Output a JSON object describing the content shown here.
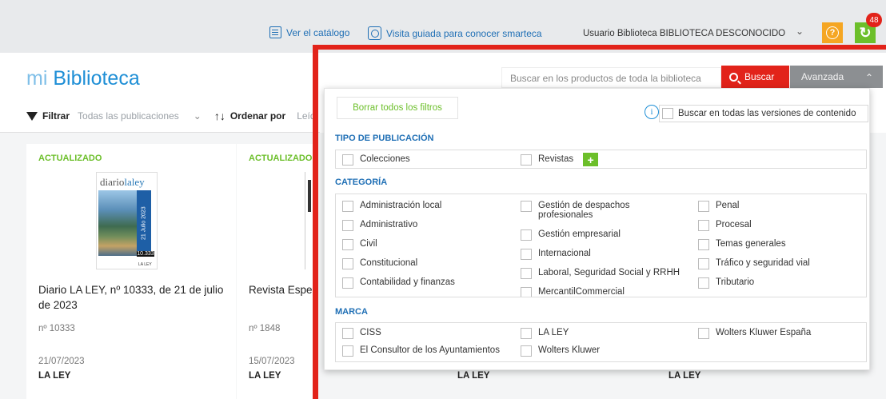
{
  "topbar": {
    "catalog_label": "Ver el catálogo",
    "tour_label": "Visita guiada para conocer smarteca",
    "user_label": "Usuario Biblioteca BIBLIOTECA DESCONOCIDO",
    "notification_count": "48"
  },
  "library": {
    "title_prefix": "mi",
    "title_main": "Biblioteca",
    "filter_label": "Filtrar",
    "filter_value": "Todas las publicaciones",
    "order_label": "Ordenar por",
    "order_value": "Leíd"
  },
  "cards": [
    {
      "status": "ACTUALIZADO",
      "title": "Diario LA LEY, nº 10333, de 21 de julio de 2023",
      "number": "nº 10333",
      "date": "21/07/2023",
      "brand": "LA LEY",
      "cover_logo_a": "diario",
      "cover_logo_b": "laley",
      "cover_date": "21 Julio 2023",
      "cover_num": "10.333",
      "cover_wk": "LA LEY"
    },
    {
      "status": "ACTUALIZADO",
      "title": "Revista Espec",
      "number": "nº 1848",
      "date": "15/07/2023",
      "brand": "LA LEY"
    }
  ],
  "background_brands": [
    "LA LEY",
    "LA LEY"
  ],
  "search": {
    "placeholder": "Buscar en los productos de toda la biblioteca",
    "button_label": "Buscar",
    "advanced_label": "Avanzada"
  },
  "panel": {
    "clear_label": "Borrar todos los filtros",
    "all_versions_label": "Buscar en todas las versiones de contenido",
    "sections": {
      "tipo": {
        "title": "TIPO DE PUBLICACIÓN",
        "options": [
          "Colecciones",
          "Revistas"
        ]
      },
      "categoria": {
        "title": "CATEGORÍA",
        "col1": [
          "Administración local",
          "Administrativo",
          "Civil",
          "Constitucional",
          "Contabilidad y finanzas"
        ],
        "col2": [
          "Gestión de despachos profesionales",
          "Gestión empresarial",
          "Internacional",
          "Laboral, Seguridad Social y RRHH",
          "MercantilCommercial"
        ],
        "col3": [
          "Penal",
          "Procesal",
          "Temas generales",
          "Tráfico y seguridad vial",
          "Tributario"
        ]
      },
      "marca": {
        "title": "MARCA",
        "col1": [
          "CISS",
          "El Consultor de los Ayuntamientos"
        ],
        "col2": [
          "LA LEY",
          "Wolters Kluwer"
        ],
        "col3": [
          "Wolters Kluwer España"
        ]
      }
    }
  },
  "colors": {
    "accent_blue": "#1f8fd6",
    "search_red": "#e2231a",
    "updated_green": "#6cbf2a",
    "help_orange": "#f5a623"
  },
  "icons": {
    "catalog": "catalog-icon",
    "tour": "tour-icon",
    "filter": "funnel-icon",
    "sort": "sort-arrows-icon",
    "search": "search-icon",
    "help": "help-icon",
    "refresh": "refresh-icon",
    "info": "info-icon",
    "plus": "plus-icon"
  }
}
